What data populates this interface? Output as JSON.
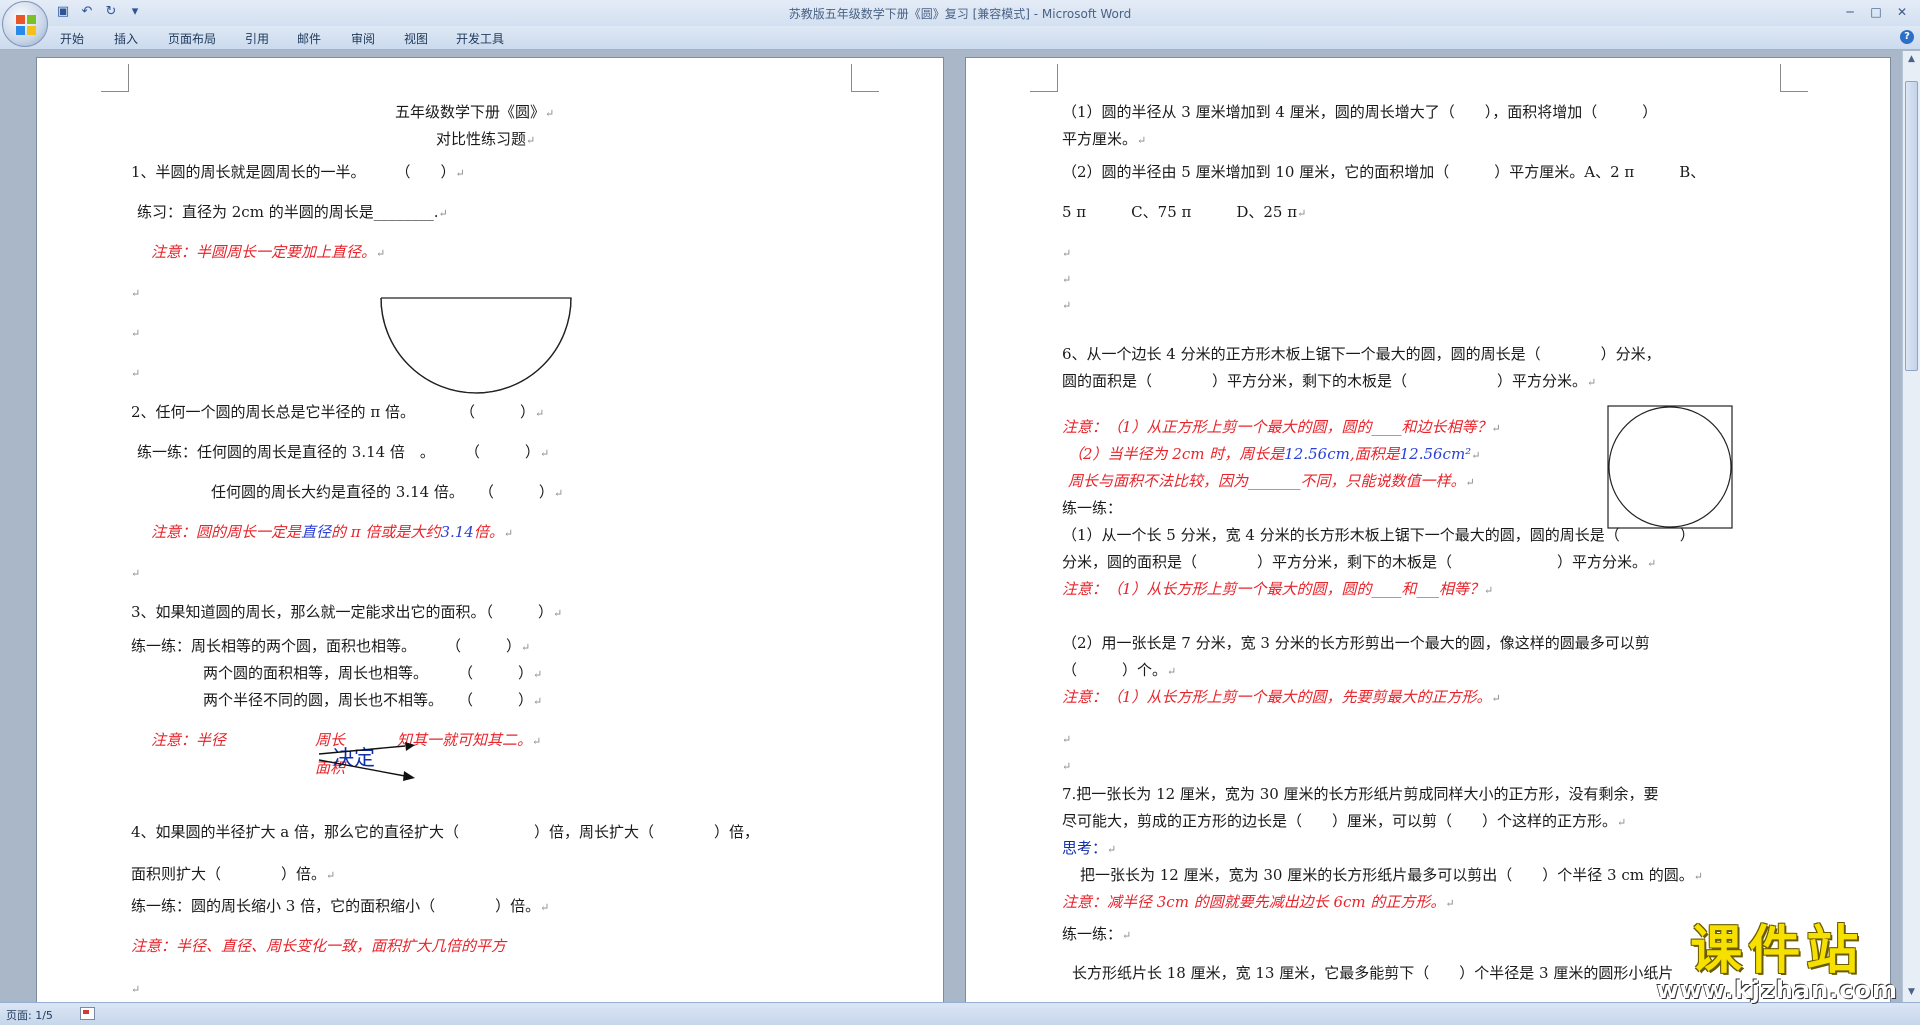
{
  "window": {
    "title": "苏教版五年级数学下册《圆》复习 [兼容模式] - Microsoft Word"
  },
  "ribbon": {
    "tabs": [
      "开始",
      "插入",
      "页面布局",
      "引用",
      "邮件",
      "审阅",
      "视图",
      "开发工具"
    ]
  },
  "statusbar": {
    "page": "页面: 1/5"
  },
  "watermark": {
    "name": "课件站",
    "url": "www.kjzhan.com"
  },
  "left_page": {
    "title": "五年级数学下册《圆》",
    "subtitle": "对比性练习题",
    "q1": "1、半圆的周长就是圆周长的一半。　　　（　　）",
    "q1_practice": "练习：直径为 2cm  的半圆的周长是________.",
    "q1_note": "注意：半圆周长一定要加上直径。",
    "q2": "2、任何一个圆的周长总是它半径的 π 倍。　　　　（　　　）",
    "q2_p1": "练一练：任何圆的周长是直径的 3.14 倍　。　　　（　　　）",
    "q2_p2": "任何圆的周长大约是直径的 3.14 倍。　　（　　　）",
    "q2_note_a": "注意：圆的周长一定是",
    "q2_note_b": "直径",
    "q2_note_c": "的 π 倍或是大约",
    "q2_note_d": "3.14",
    "q2_note_e": "倍。",
    "q3": "3、如果知道圆的周长，那么就一定能求出它的面积。（　　　）",
    "q3_p1": "练一练：周长相等的两个圆，面积也相等。　　　（　　　）",
    "q3_p2": "两个圆的面积相等，周长也相等。　　　（　　　）",
    "q3_p3": "两个半径不同的圆，周长也不相等。　　（　　　）",
    "q3_note_a": "注意：半径",
    "q3_note_b": "周长",
    "q3_note_c": "知其一就可知其二。",
    "q3_note_d": "面积",
    "q3_note_e": "决定",
    "q4": "4、如果圆的半径扩大 a 倍，那么它的直径扩大（　　　　　）倍，周长扩大（　　　　）倍，",
    "q4_b": "面积则扩大（　　　　）倍。",
    "q4_p1": "练一练：圆的周长缩小 3 倍，它的面积缩小（　　　　）倍。",
    "q4_note": "注意：半径、直径、周长变化一致，面积扩大几倍的平方"
  },
  "right_page": {
    "r1": "（1）圆的半径从 3 厘米增加到 4 厘米，圆的周长增大了（　　），面积将增加（　　　）",
    "r1b": "平方厘米。",
    "r2": "（2）圆的半径由 5 厘米增加到 10 厘米，它的面积增加（　　　）平方厘米。A、2 π　　　B、",
    "r2b": "5 π　　　C、75 π　　　D、25 π",
    "q6": "6、从一个边长 4 分米的正方形木板上锯下一个最大的圆，圆的周长是（　　　　）分米，",
    "q6b": "圆的面积是（　　　　）平方分米，剩下的木板是（　　　　　　）平方分米。",
    "q6_n1": "注意：（1）从正方形上剪一个最大的圆，圆的____和边长相等？",
    "q6_n2a": "（2）当半径为 2cm 时，周长是",
    "q6_n2b": "12.56cm",
    "q6_n2c": ",面积是",
    "q6_n2d": "12.56cm²",
    "q6_n3": "周长与面积不法比较，因为_______不同，只能说数值一样。",
    "q6_p": "练一练：",
    "q6_p1": "（1）从一个长 5 分米，宽 4 分米的长方形木板上锯下一个最大的圆，圆的周长是（　　　　）",
    "q6_p1b": "分米，圆的面积是（　　　　）平方分米，剩下的木板是（　　　　　　　）平方分米。",
    "q6_p1n": "注意：（1）从长方形上剪一个最大的圆，圆的____和___相等？",
    "q6_p2": "（2）用一张长是  7  分米，宽  3  分米的长方形剪出一个最大的圆，像这样的圆最多可以剪",
    "q6_p2b": "（　　　）个。",
    "q6_p2n": "注意：（1）从长方形上剪一个最大的圆，先要剪最大的正方形。",
    "q7": "7.把一张长为 12 厘米，宽为 30 厘米的长方形纸片剪成同样大小的正方形，没有剩余，要",
    "q7b": "尽可能大，剪成的正方形的边长是（　　）厘米，可以剪（　　）个这样的正方形。",
    "think": "思考：",
    "think1": "把一张长为 12 厘米，宽为 30 厘米的长方形纸片最多可以剪出（　　）个半径 3 cm 的圆。",
    "think_note": "注意：减半径 3cm 的圆就要先减出边长 6cm 的正方形。",
    "last_p": "练一练：",
    "last_line": "长方形纸片长 18 厘米，宽 13 厘米，它最多能剪下（　　）个半径是 3 厘米的圆形小纸片"
  }
}
